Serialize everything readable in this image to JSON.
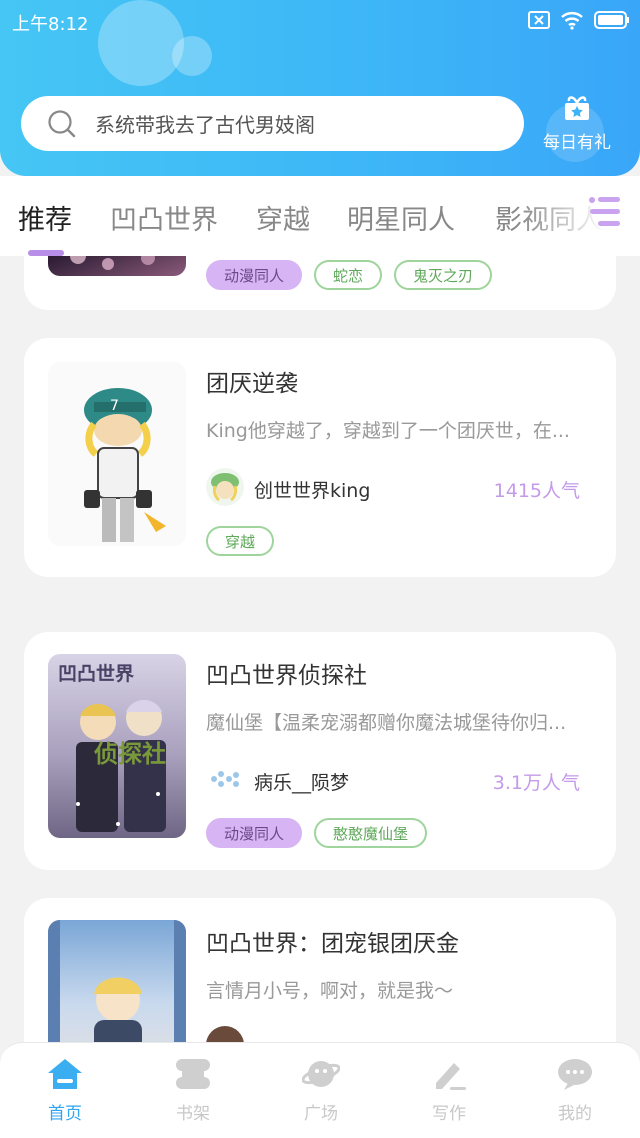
{
  "status_bar": {
    "time": "上午8:12"
  },
  "search": {
    "text": "系统带我去了古代男妓阁"
  },
  "gift": {
    "label": "每日有礼"
  },
  "tabs": [
    {
      "label": "推荐",
      "active": true
    },
    {
      "label": "凹凸世界",
      "active": false
    },
    {
      "label": "穿越",
      "active": false
    },
    {
      "label": "明星同人",
      "active": false
    },
    {
      "label": "影视同人",
      "active": false
    }
  ],
  "cards": [
    {
      "title": "",
      "tags": [
        {
          "label": "动漫同人",
          "style": "filled"
        },
        {
          "label": "蛇恋",
          "style": "outline"
        },
        {
          "label": "鬼灭之刃",
          "style": "outline"
        }
      ]
    },
    {
      "title": "团厌逆袭",
      "desc": "King他穿越了，穿越到了一个团厌世，在...",
      "author": "创世世界king",
      "popularity": "1415人气",
      "tags": [
        {
          "label": "穿越",
          "style": "outline"
        }
      ]
    },
    {
      "title": "凹凸世界侦探社",
      "desc": "魔仙堡【温柔宠溺都赠你魔法城堡待你归...",
      "author": "病乐__陨梦",
      "popularity": "3.1万人气",
      "tags": [
        {
          "label": "动漫同人",
          "style": "filled"
        },
        {
          "label": "憨憨魔仙堡",
          "style": "outline"
        }
      ],
      "cover_text": {
        "top": "凹凸世界",
        "main": "侦探社"
      }
    },
    {
      "title": "凹凸世界：团宠银团厌金",
      "desc": "言情月小号，啊对，就是我～",
      "author": "",
      "popularity": ""
    }
  ],
  "bottom_nav": [
    {
      "label": "首页",
      "icon": "home-icon",
      "active": true
    },
    {
      "label": "书架",
      "icon": "bookshelf-icon",
      "active": false
    },
    {
      "label": "广场",
      "icon": "planet-icon",
      "active": false
    },
    {
      "label": "写作",
      "icon": "pen-icon",
      "active": false
    },
    {
      "label": "我的",
      "icon": "chat-bubble-icon",
      "active": false
    }
  ],
  "colors": {
    "header_gradient_start": "#45c6f4",
    "header_gradient_end": "#3aa6f8",
    "tab_underline": "#b98ee8",
    "tag_filled": "#d7b4f3",
    "tag_outline": "#9fd59c",
    "popularity": "#c39be8",
    "nav_active": "#2fa6ee"
  }
}
